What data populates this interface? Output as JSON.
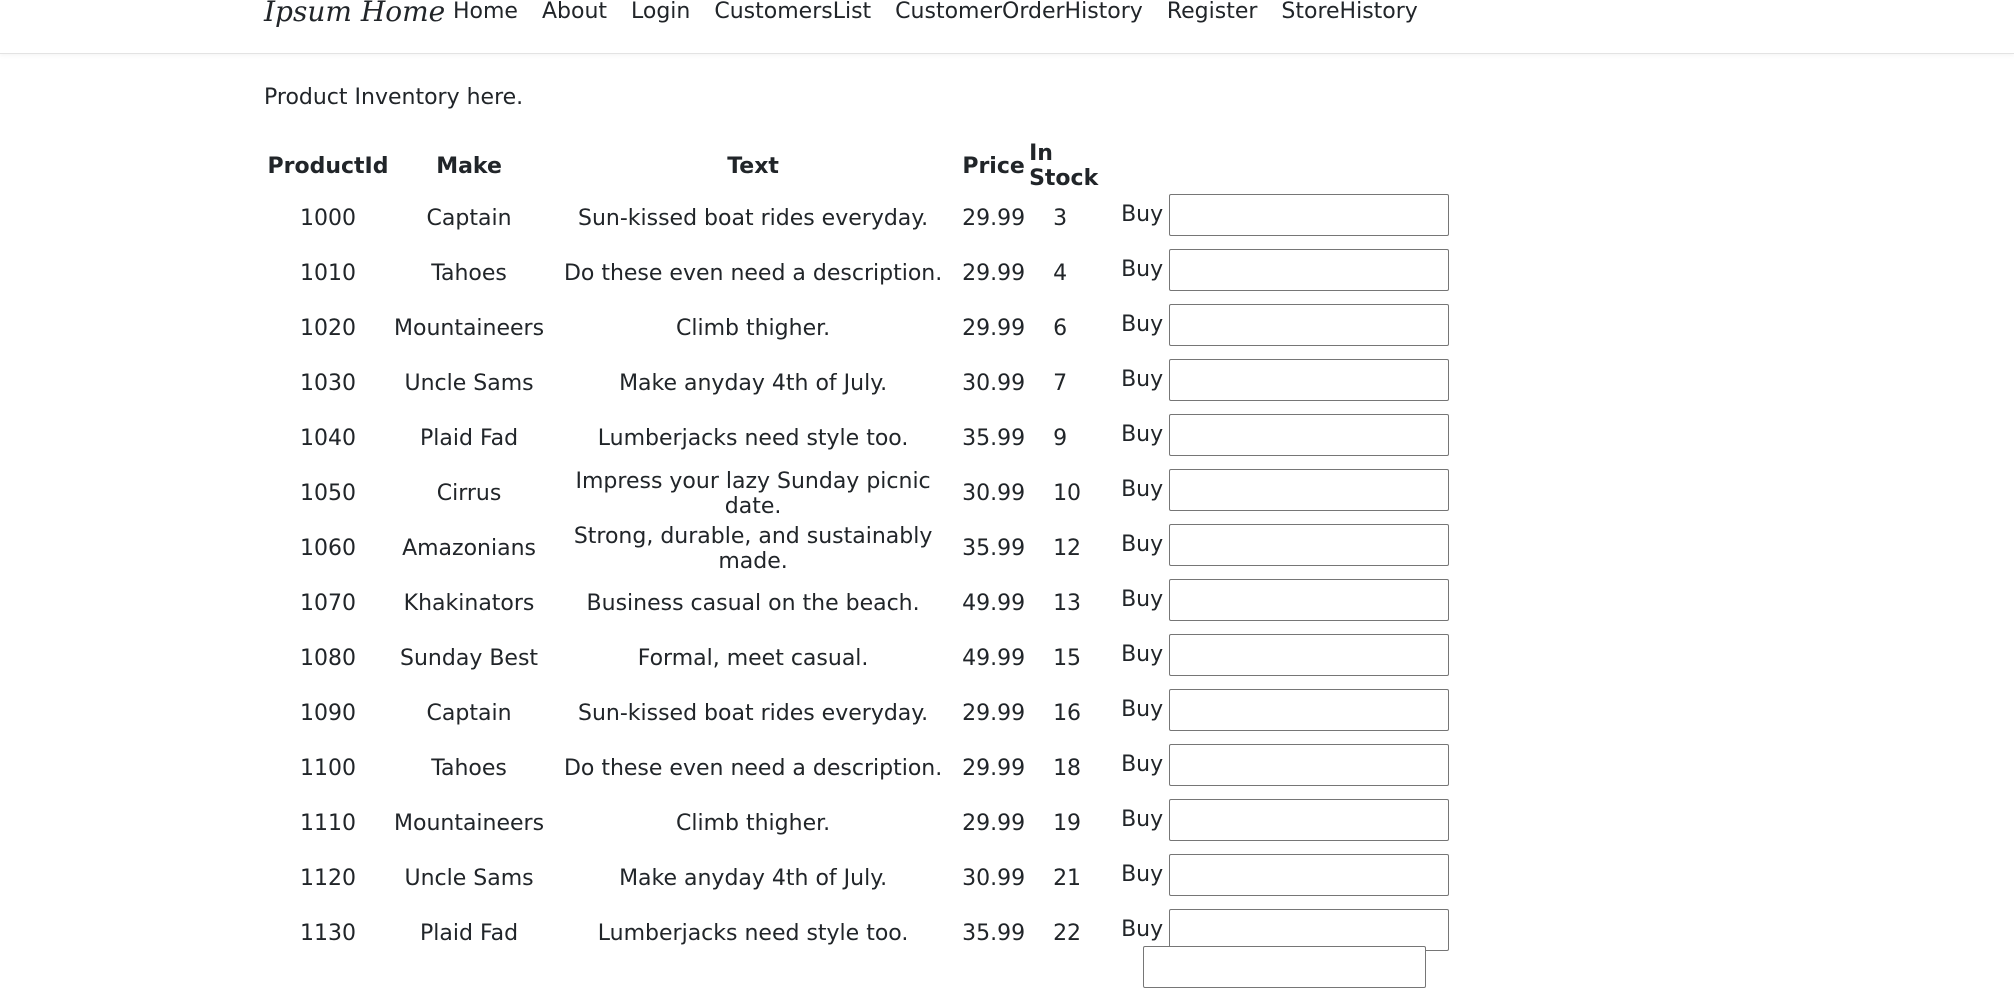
{
  "navbar": {
    "brand": "Ipsum Home",
    "links": [
      "Home",
      "About",
      "Login",
      "CustomersList",
      "CustomerOrderHistory",
      "Register",
      "StoreHistory"
    ]
  },
  "intro": "Product Inventory here.",
  "table": {
    "headers": [
      "ProductId",
      "Make",
      "Text",
      "Price",
      "In Stock"
    ],
    "buy_label": "Buy",
    "rows": [
      [
        "1000",
        "Captain",
        "Sun-kissed boat rides everyday.",
        "29.99",
        "3"
      ],
      [
        "1010",
        "Tahoes",
        "Do these even need a description.",
        "29.99",
        "4"
      ],
      [
        "1020",
        "Mountaineers",
        "Climb thigher.",
        "29.99",
        "6"
      ],
      [
        "1030",
        "Uncle Sams",
        "Make anyday 4th of July.",
        "30.99",
        "7"
      ],
      [
        "1040",
        "Plaid Fad",
        "Lumberjacks need style too.",
        "35.99",
        "9"
      ],
      [
        "1050",
        "Cirrus",
        "Impress your lazy Sunday picnic date.",
        "30.99",
        "10"
      ],
      [
        "1060",
        "Amazonians",
        "Strong, durable, and sustainably made.",
        "35.99",
        "12"
      ],
      [
        "1070",
        "Khakinators",
        "Business casual on the beach.",
        "49.99",
        "13"
      ],
      [
        "1080",
        "Sunday Best",
        "Formal, meet casual.",
        "49.99",
        "15"
      ],
      [
        "1090",
        "Captain",
        "Sun-kissed boat rides everyday.",
        "29.99",
        "16"
      ],
      [
        "1100",
        "Tahoes",
        "Do these even need a description.",
        "29.99",
        "18"
      ],
      [
        "1110",
        "Mountaineers",
        "Climb thigher.",
        "29.99",
        "19"
      ],
      [
        "1120",
        "Uncle Sams",
        "Make anyday 4th of July.",
        "30.99",
        "21"
      ],
      [
        "1130",
        "Plaid Fad",
        "Lumberjacks need style too.",
        "35.99",
        "22"
      ]
    ]
  }
}
